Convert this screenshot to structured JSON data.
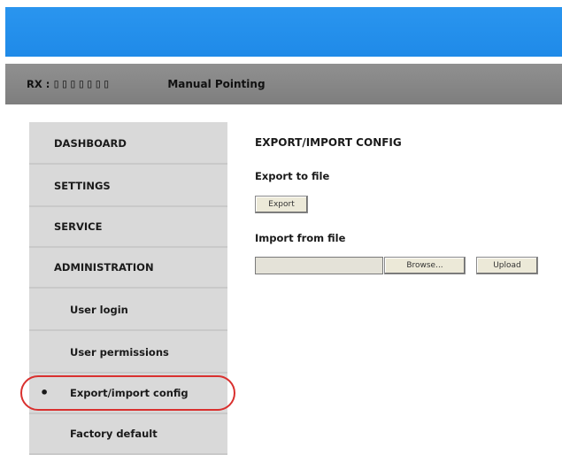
{
  "header": {
    "rx_label": "RX :",
    "rx_value": "▯▯▯▯▯▯▯",
    "mode": "Manual Pointing"
  },
  "sidebar": {
    "items": [
      {
        "label": "DASHBOARD"
      },
      {
        "label": "SETTINGS"
      },
      {
        "label": "SERVICE"
      },
      {
        "label": "ADMINISTRATION"
      },
      {
        "label": "User login"
      },
      {
        "label": "User permissions"
      },
      {
        "label": "Export/import config",
        "active": true,
        "bullet": "•"
      },
      {
        "label": "Factory default"
      }
    ]
  },
  "main": {
    "title": "EXPORT/IMPORT CONFIG",
    "export_label": "Export to file",
    "export_button": "Export",
    "import_label": "Import from file",
    "browse_button": "Browse...",
    "upload_button": "Upload"
  },
  "colors": {
    "topbar": "#1f8ae8",
    "statusbar": "#868686",
    "sidebar": "#d9d9d9",
    "highlight": "#d9302e"
  }
}
